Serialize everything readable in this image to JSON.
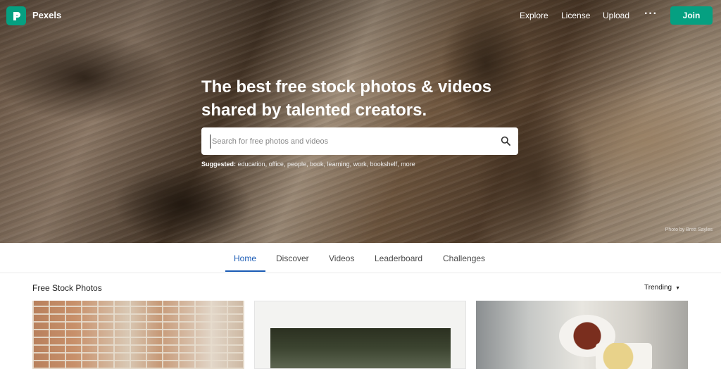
{
  "brand": {
    "name": "Pexels",
    "accent": "#05a081"
  },
  "nav": {
    "links": [
      {
        "label": "Explore"
      },
      {
        "label": "License"
      },
      {
        "label": "Upload"
      }
    ],
    "more_label": "···",
    "join_label": "Join"
  },
  "hero": {
    "headline_line1": "The best free stock photos & videos",
    "headline_line2": "shared by talented creators.",
    "search_placeholder": "Search for free photos and videos",
    "suggested_label": "Suggested:",
    "suggested_tags": [
      "education",
      "office",
      "people",
      "book",
      "learning",
      "work",
      "bookshelf",
      "more"
    ],
    "photo_credit": "Photo by Brett Sayles"
  },
  "tabs": [
    {
      "label": "Home",
      "active": true
    },
    {
      "label": "Discover",
      "active": false
    },
    {
      "label": "Videos",
      "active": false
    },
    {
      "label": "Leaderboard",
      "active": false
    },
    {
      "label": "Challenges",
      "active": false
    }
  ],
  "section": {
    "title": "Free Stock Photos",
    "sort_label": "Trending",
    "caret": "▼"
  },
  "icons": {
    "logo": "pexels-logo-icon",
    "search": "search-icon",
    "more": "more-dots-icon",
    "sort": "caret-down-icon"
  }
}
